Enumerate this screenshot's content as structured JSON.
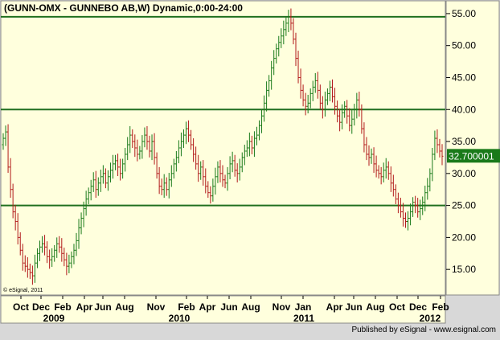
{
  "chart_data": {
    "type": "bar",
    "subtype": "ohlc-weekly",
    "title": "(GUNN-OMX - GUNNEBO AB,W) Dynamic,0:00-24:00",
    "copyright": "© eSignal, 2011",
    "footer": "Published by eSignal - www.esignal.com",
    "ylim": [
      11,
      57
    ],
    "yticks": [
      15,
      20,
      25,
      30,
      35,
      40,
      45,
      50,
      55
    ],
    "ytick_labels": [
      "15.00",
      "20.00",
      "25.00",
      "30.00",
      "35.00",
      "40.00",
      "45.00",
      "50.00",
      "55.00"
    ],
    "grid": false,
    "last_price": "32.700001",
    "x_month_labels": [
      "Oct",
      "Dec",
      "Feb",
      "Apr",
      "Jun",
      "Aug",
      "Nov",
      "Feb",
      "Apr",
      "Jun",
      "Aug",
      "Nov",
      "Jan",
      "Apr",
      "Jun",
      "Aug",
      "Oct",
      "Dec",
      "Feb"
    ],
    "x_year_labels": [
      "2009",
      "2010",
      "2011",
      "2012"
    ],
    "horizontal_lines": [
      54.5,
      40.0,
      25.0
    ],
    "colors": {
      "up": "#1a7a1a",
      "down": "#b21a1a",
      "hline": "#1f6f1f",
      "plot_bg": "#ffffdd",
      "price_box": "#1a7a1a"
    },
    "weekly_closes": [
      35.5,
      36.5,
      31.0,
      27.5,
      24.0,
      22.5,
      20.0,
      18.0,
      16.0,
      15.5,
      15.0,
      14.5,
      14.0,
      16.0,
      17.5,
      18.5,
      19.0,
      18.5,
      17.0,
      16.5,
      17.0,
      18.0,
      19.0,
      18.5,
      17.5,
      16.5,
      15.5,
      16.0,
      17.0,
      18.0,
      19.5,
      21.5,
      23.0,
      24.5,
      26.0,
      27.0,
      28.0,
      29.0,
      27.5,
      28.5,
      29.5,
      30.0,
      28.5,
      29.5,
      30.5,
      31.5,
      32.0,
      31.0,
      30.0,
      31.5,
      33.0,
      34.5,
      36.0,
      35.0,
      34.0,
      33.0,
      33.5,
      35.0,
      36.0,
      35.0,
      33.5,
      35.0,
      32.5,
      30.0,
      28.0,
      27.5,
      28.5,
      27.5,
      29.0,
      30.0,
      31.5,
      32.5,
      34.0,
      35.0,
      36.0,
      37.0,
      36.0,
      34.5,
      33.0,
      31.5,
      30.0,
      31.0,
      29.5,
      28.0,
      27.0,
      26.5,
      28.0,
      29.5,
      31.0,
      30.0,
      29.0,
      28.5,
      30.0,
      31.5,
      32.0,
      30.5,
      30.0,
      31.0,
      32.5,
      33.5,
      34.0,
      35.0,
      34.0,
      35.5,
      36.0,
      37.5,
      39.0,
      41.0,
      43.0,
      44.5,
      46.5,
      48.0,
      49.5,
      50.5,
      51.5,
      52.5,
      53.5,
      54.5,
      53.5,
      51.0,
      48.0,
      45.0,
      43.0,
      41.5,
      40.5,
      41.0,
      42.5,
      43.5,
      44.5,
      43.0,
      41.0,
      40.0,
      41.5,
      42.5,
      43.5,
      42.0,
      40.5,
      39.0,
      38.0,
      39.5,
      40.5,
      39.0,
      37.5,
      38.5,
      40.0,
      41.5,
      40.0,
      37.0,
      34.5,
      33.0,
      32.5,
      33.0,
      31.5,
      30.5,
      30.0,
      29.5,
      30.5,
      31.0,
      30.0,
      28.5,
      27.5,
      26.0,
      25.0,
      24.0,
      23.0,
      22.5,
      23.0,
      24.0,
      25.5,
      25.0,
      24.0,
      24.5,
      25.5,
      27.0,
      28.0,
      30.0,
      33.0,
      35.5,
      34.5,
      33.5,
      32.7
    ]
  }
}
